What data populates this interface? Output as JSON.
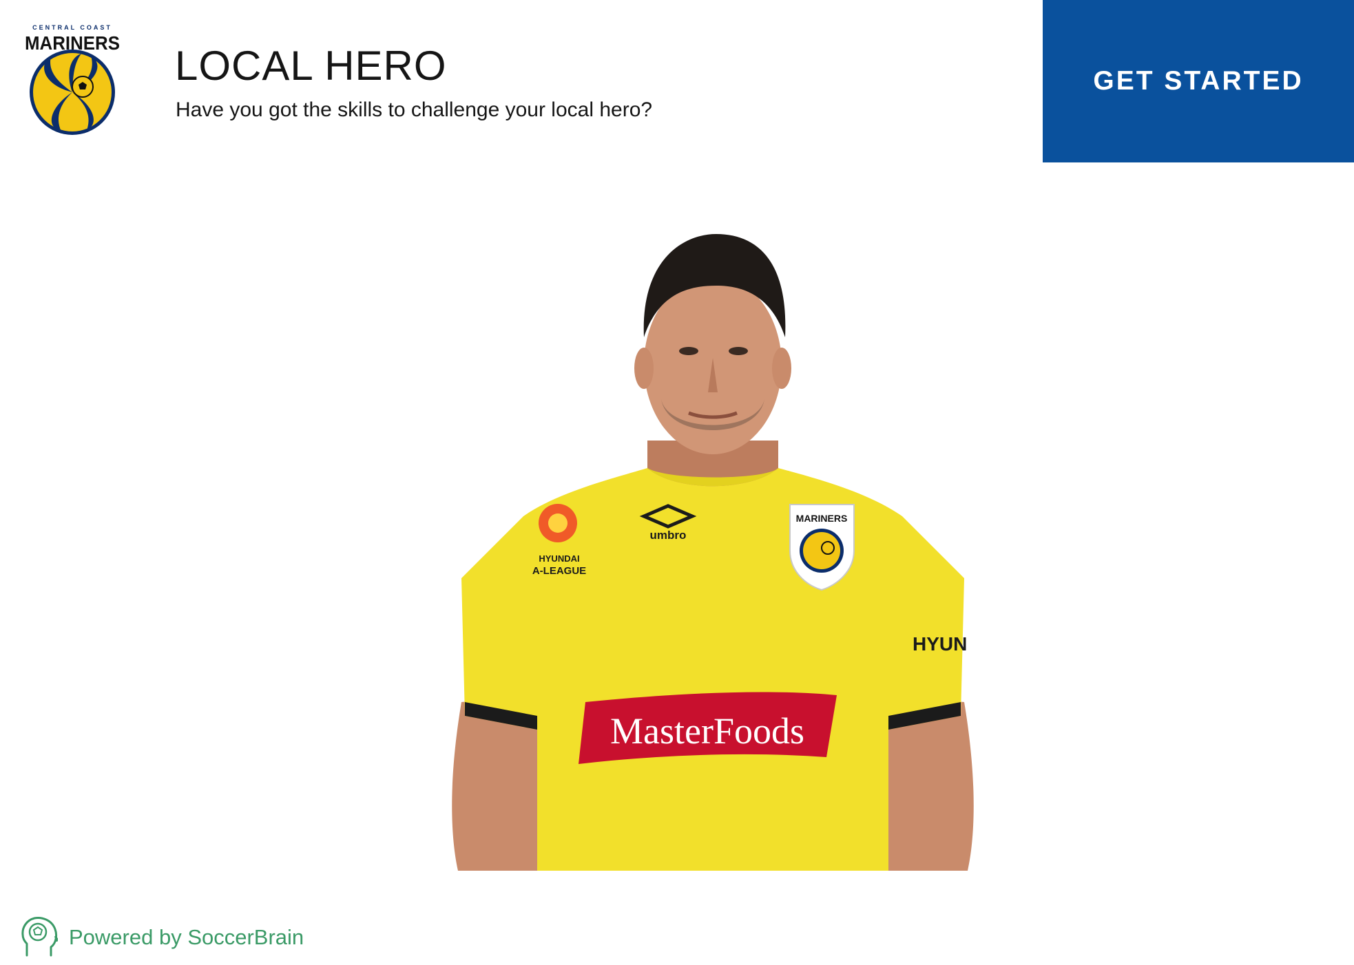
{
  "header": {
    "logo": {
      "top_text": "CENTRAL COAST",
      "name": "MARINERS"
    },
    "title": "LOCAL HERO",
    "subtitle": "Have you got the skills to challenge your local hero?",
    "cta_label": "GET STARTED"
  },
  "hero_photo": {
    "shirt_sponsor": "MasterFoods",
    "kit_brand": "umbro",
    "league_badge": [
      "HYUNDAI",
      "A-LEAGUE"
    ],
    "crest_text": "MARINERS",
    "sleeve_sponsor": "HYUN"
  },
  "footer": {
    "powered_by": "Powered by SoccerBrain",
    "icon": "brain-head-icon"
  },
  "colors": {
    "accent_blue": "#0a519d",
    "footer_green": "#3a9a66",
    "jersey_yellow": "#f2e02b",
    "sponsor_red": "#c8102e",
    "crest_gold": "#f3c614",
    "crest_navy": "#0b2d6b"
  }
}
